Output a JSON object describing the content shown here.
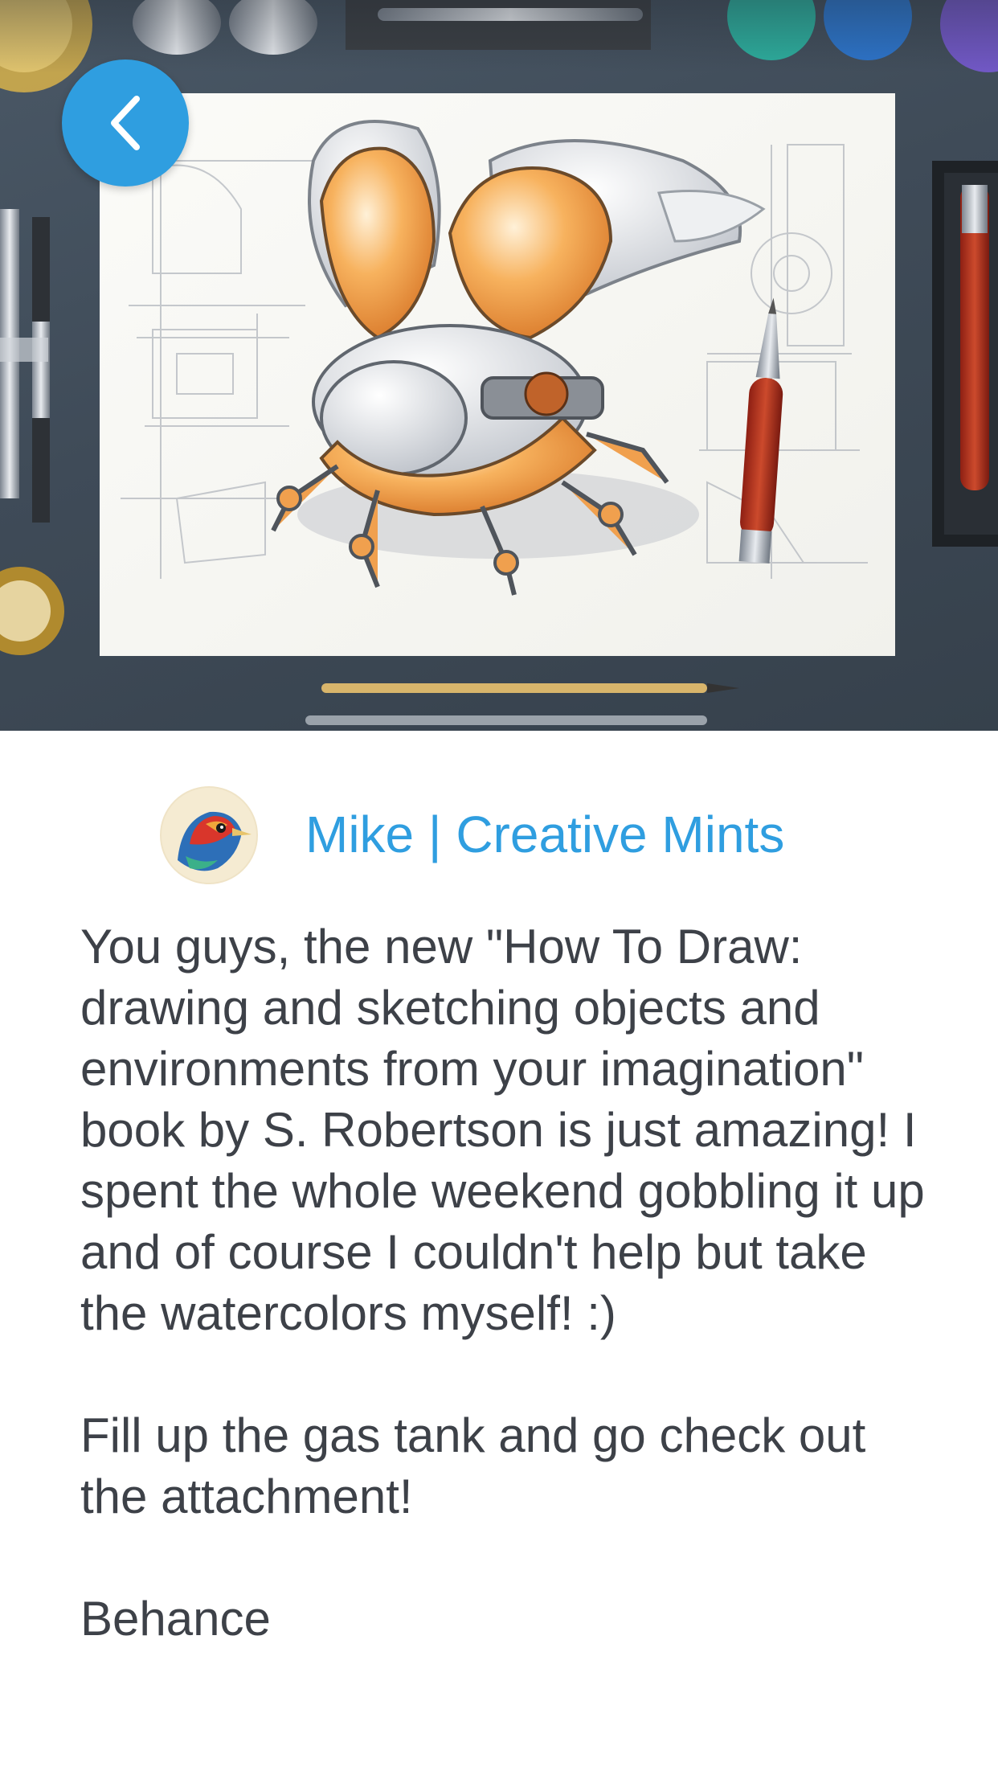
{
  "post": {
    "author_name": "Mike | Creative Mints",
    "body": "You guys, the new \"How To Draw: drawing and sketching objects and environments from your imagination\" book by S. Robertson is just amazing! I spent the whole weekend gobbling it up and of course I couldn't help but take the watercolors myself! :)\n\nFill up the gas tank and go check out the attachment!\n\nBehance"
  },
  "colors": {
    "accent": "#2f9ee0",
    "text": "#3d4148",
    "background": "#ffffff"
  },
  "icons": {
    "back": "chevron-left-icon"
  }
}
